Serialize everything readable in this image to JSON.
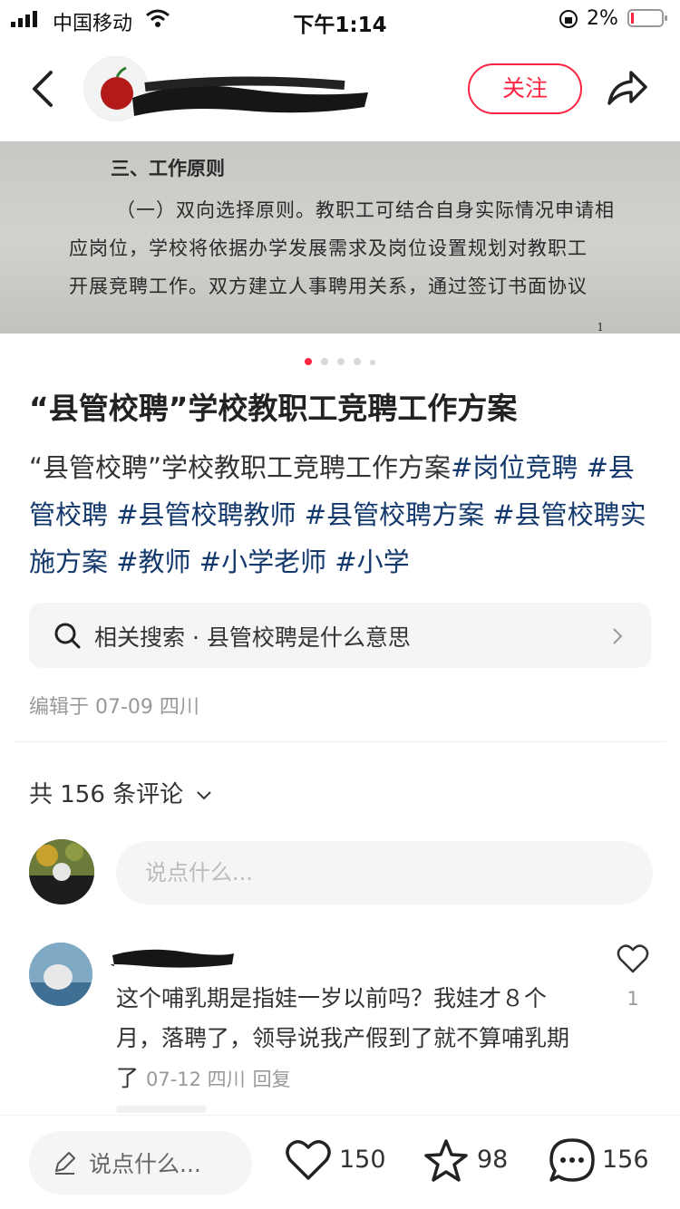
{
  "status_bar": {
    "carrier": "中国移动",
    "time": "下午1:14",
    "battery": "2%"
  },
  "header": {
    "follow_label": "关注"
  },
  "photo": {
    "heading": "三、工作原则",
    "lines": [
      "（一）双向选择原则。教职工可结合自身实际情况申请相",
      "应岗位，学校将依据办学发展需求及岗位设置规划对教职工",
      "开展竞聘工作。双方建立人事聘用关系，通过签订书面协议"
    ],
    "page_number": "1"
  },
  "post": {
    "title": "“县管校聘”学校教职工竞聘工作方案",
    "desc_prefix": "“县管校聘”学校教职工竞聘工作方案",
    "tags": [
      "#岗位竞聘",
      "#县管校聘",
      "#县管校聘教师",
      "#县管校聘方案",
      "#县管校聘实施方案",
      "#教师",
      "#小学老师",
      "#小学"
    ],
    "related_search": "相关搜索 · 县管校聘是什么意思",
    "edited": "编辑于 07-09 四川"
  },
  "comments": {
    "count_label": "共 156 条评论",
    "input_placeholder": "说点什么...",
    "items": [
      {
        "text": "这个哺乳期是指娃一岁以前吗？我娃才８个月，落聘了，领导说我产假到了就不算哺乳期了",
        "date": "07-12 四川",
        "reply": "回复",
        "likes": "1"
      }
    ]
  },
  "bottom_bar": {
    "input_label": "说点什么...",
    "likes": "150",
    "stars": "98",
    "comments": "156"
  },
  "colors": {
    "accent": "#ff2442",
    "tag": "#13386c"
  }
}
